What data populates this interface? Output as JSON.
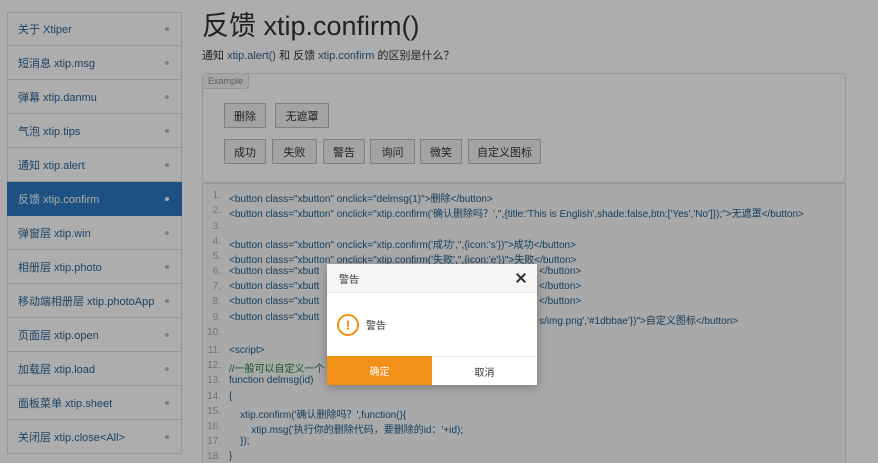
{
  "sidebar": {
    "items": [
      {
        "label": "关于 Xtiper",
        "active": false
      },
      {
        "label": "短消息 xtip.msg",
        "active": false
      },
      {
        "label": "弹幕 xtip.danmu",
        "active": false
      },
      {
        "label": "气泡 xtip.tips",
        "active": false
      },
      {
        "label": "通知 xtip.alert",
        "active": false
      },
      {
        "label": "反馈 xtip.confirm",
        "active": true
      },
      {
        "label": "弹窗层 xtip.win",
        "active": false
      },
      {
        "label": "相册层 xtip.photo",
        "active": false
      },
      {
        "label": "移动端相册层 xtip.photoApp",
        "active": false
      },
      {
        "label": "页面层 xtip.open",
        "active": false
      },
      {
        "label": "加载层 xtip.load",
        "active": false
      },
      {
        "label": "面板菜单 xtip.sheet",
        "active": false
      },
      {
        "label": "关闭层 xtip.close<All>",
        "active": false
      }
    ]
  },
  "main": {
    "title": "反馈 xtip.confirm()",
    "desc": {
      "pre": "通知 ",
      "link1": "xtip.alert()",
      "mid": " 和 反馈 ",
      "link2": "xtip.confirm",
      "post": " 的区别是什么？"
    }
  },
  "example": {
    "tag": "Example",
    "row1": [
      "删除",
      "无遮罩"
    ],
    "row2": [
      "成功",
      "失败",
      "警告",
      "询问",
      "微笑",
      "自定义图标"
    ]
  },
  "code": {
    "lines": [
      {
        "num": "1.",
        "text": "<button class=\"xbutton\" onclick=\"delmsg(1)\">删除</button>"
      },
      {
        "num": "2.",
        "text": "<button class=\"xbutton\" onclick=\"xtip.confirm('确认删除吗？','',{title:'This is English',shade:false,btn:['Yes','No']});\">无遮罩</button>"
      },
      {
        "num": "3.",
        "text": ""
      },
      {
        "num": "4.",
        "text": "<button class=\"xbutton\" onclick=\"xtip.confirm('成功','',{icon:'s'})\">成功</button>"
      },
      {
        "num": "5.",
        "text": "<button class=\"xbutton\" onclick=\"xtip.confirm('失败','',{icon:'e'})\">失败</button>"
      },
      {
        "num": "6.",
        "text": "<button class=\"xbutt"
      },
      {
        "num": "7.",
        "text": "<button class=\"xbutt"
      },
      {
        "num": "8.",
        "text": "<button class=\"xbutt"
      },
      {
        "num": "9.",
        "text": "<button class=\"xbutt"
      },
      {
        "num": "10.",
        "text": ""
      },
      {
        "num": "11.",
        "text": "<script>"
      },
      {
        "num": "12.",
        "text": "//一般可以自定义一个"
      },
      {
        "num": "13.",
        "text": "function delmsg(id)"
      },
      {
        "num": "14.",
        "text": "{"
      },
      {
        "num": "15.",
        "text": "    xtip.confirm('确认删除吗？',function(){"
      },
      {
        "num": "16.",
        "text": "        xtip.msg('执行你的删除代码，要删除的id：'+id);"
      },
      {
        "num": "17.",
        "text": "    });"
      },
      {
        "num": "18.",
        "text": "}"
      }
    ],
    "tails": {
      "line6": "</button>",
      "line7": "</button>",
      "line8": "</button>",
      "line9": "s/img.png','#1dbbae'})\">自定义图标</button>"
    }
  },
  "dialog": {
    "title": "警告",
    "message": "警告",
    "icon": "!",
    "ok": "确定",
    "cancel": "取消",
    "accent": "#f39017"
  }
}
